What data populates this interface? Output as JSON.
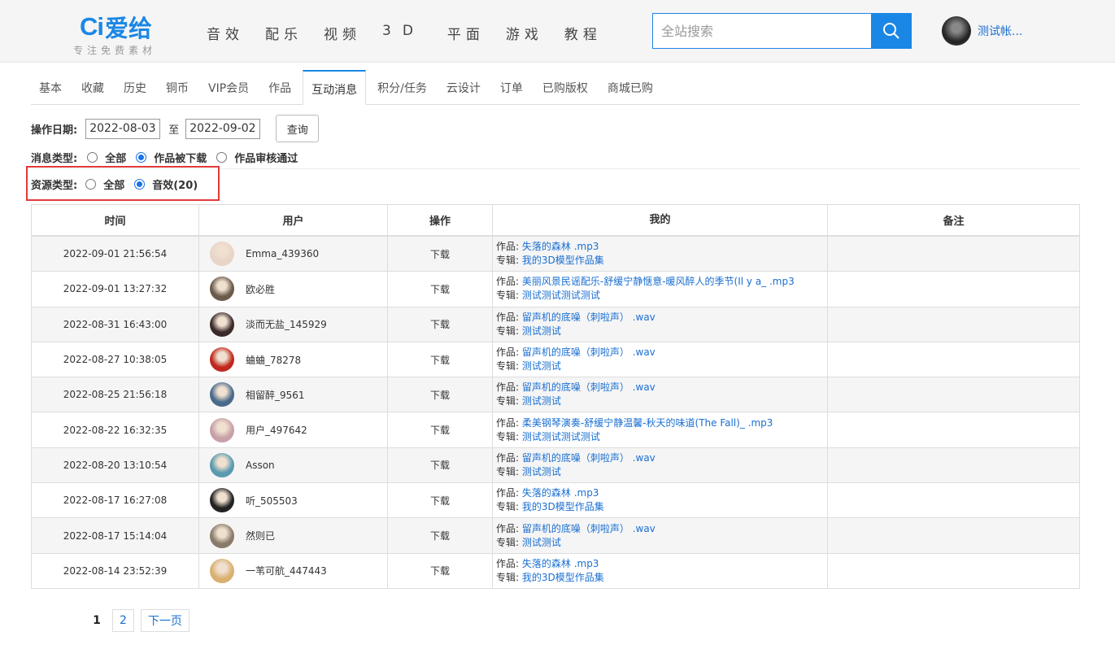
{
  "header": {
    "logo_mark": "Ci",
    "logo_name": "爱给",
    "logo_tagline": "专注免费素材",
    "nav": [
      "音效",
      "配乐",
      "视频",
      "3D",
      "平面",
      "游戏",
      "教程"
    ],
    "search_placeholder": "全站搜索",
    "user_name": "测试帐..."
  },
  "tabs": [
    "基本",
    "收藏",
    "历史",
    "铜币",
    "VIP会员",
    "作品",
    "互动消息",
    "积分/任务",
    "云设计",
    "订单",
    "已购版权",
    "商城已购"
  ],
  "active_tab": "互动消息",
  "filters": {
    "date_label": "操作日期:",
    "date_from": "2022-08-03",
    "date_to_sep": "至",
    "date_to": "2022-09-02",
    "query_button": "查询",
    "msg_type_label": "消息类型:",
    "msg_types": [
      "全部",
      "作品被下载",
      "作品审核通过"
    ],
    "msg_type_selected": "作品被下载",
    "res_type_label": "资源类型:",
    "res_types": [
      "全部",
      "音效(20)"
    ],
    "res_type_selected": "音效(20)"
  },
  "table": {
    "columns": [
      "时间",
      "用户",
      "操作",
      "我的",
      "备注"
    ],
    "work_label": "作品:",
    "album_label": "专辑:",
    "rows": [
      {
        "time": "2022-09-01 21:56:54",
        "user": "Emma_439360",
        "action": "下载",
        "work": "失落的森林 .mp3",
        "album": "我的3D模型作品集",
        "note": "",
        "avatar_color": "#e8d5c8"
      },
      {
        "time": "2022-09-01 13:27:32",
        "user": "欧必胜",
        "action": "下载",
        "work": "美丽风景民谣配乐-舒缓宁静惬意-暖风醉人的季节(Il y a_ .mp3",
        "album": "测试测试测试测试",
        "note": "",
        "avatar_color": "#6b5a4a"
      },
      {
        "time": "2022-08-31 16:43:00",
        "user": "淡而无盐_145929",
        "action": "下载",
        "work": "留声机的底噪（刺啦声） .wav",
        "album": "测试测试",
        "note": "",
        "avatar_color": "#3a2a2a"
      },
      {
        "time": "2022-08-27 10:38:05",
        "user": "蛐蛐_78278",
        "action": "下载",
        "work": "留声机的底噪（刺啦声） .wav",
        "album": "测试测试",
        "note": "",
        "avatar_color": "#c0281e"
      },
      {
        "time": "2022-08-25 21:56:18",
        "user": "相留醉_9561",
        "action": "下载",
        "work": "留声机的底噪（刺啦声） .wav",
        "album": "测试测试",
        "note": "",
        "avatar_color": "#4a6a8a"
      },
      {
        "time": "2022-08-22 16:32:35",
        "user": "用户_497642",
        "action": "下载",
        "work": "柔美钢琴演奏-舒缓宁静温馨-秋天的味道(The Fall)_ .mp3",
        "album": "测试测试测试测试",
        "note": "",
        "avatar_color": "#c8a0a8"
      },
      {
        "time": "2022-08-20 13:10:54",
        "user": "Asson",
        "action": "下载",
        "work": "留声机的底噪（刺啦声） .wav",
        "album": "测试测试",
        "note": "",
        "avatar_color": "#5a9ab0"
      },
      {
        "time": "2022-08-17 16:27:08",
        "user": "听_505503",
        "action": "下载",
        "work": "失落的森林 .mp3",
        "album": "我的3D模型作品集",
        "note": "",
        "avatar_color": "#222222"
      },
      {
        "time": "2022-08-17 15:14:04",
        "user": "然则已",
        "action": "下载",
        "work": "留声机的底噪（刺啦声） .wav",
        "album": "测试测试",
        "note": "",
        "avatar_color": "#8a7a6a"
      },
      {
        "time": "2022-08-14 23:52:39",
        "user": "一苇可航_447443",
        "action": "下载",
        "work": "失落的森林 .mp3",
        "album": "我的3D模型作品集",
        "note": "",
        "avatar_color": "#d9b070"
      }
    ]
  },
  "pagination": {
    "current": "1",
    "pages": [
      "2"
    ],
    "next": "下一页"
  },
  "colors": {
    "accent": "#1a87e6",
    "highlight_border": "#e03a3a"
  }
}
